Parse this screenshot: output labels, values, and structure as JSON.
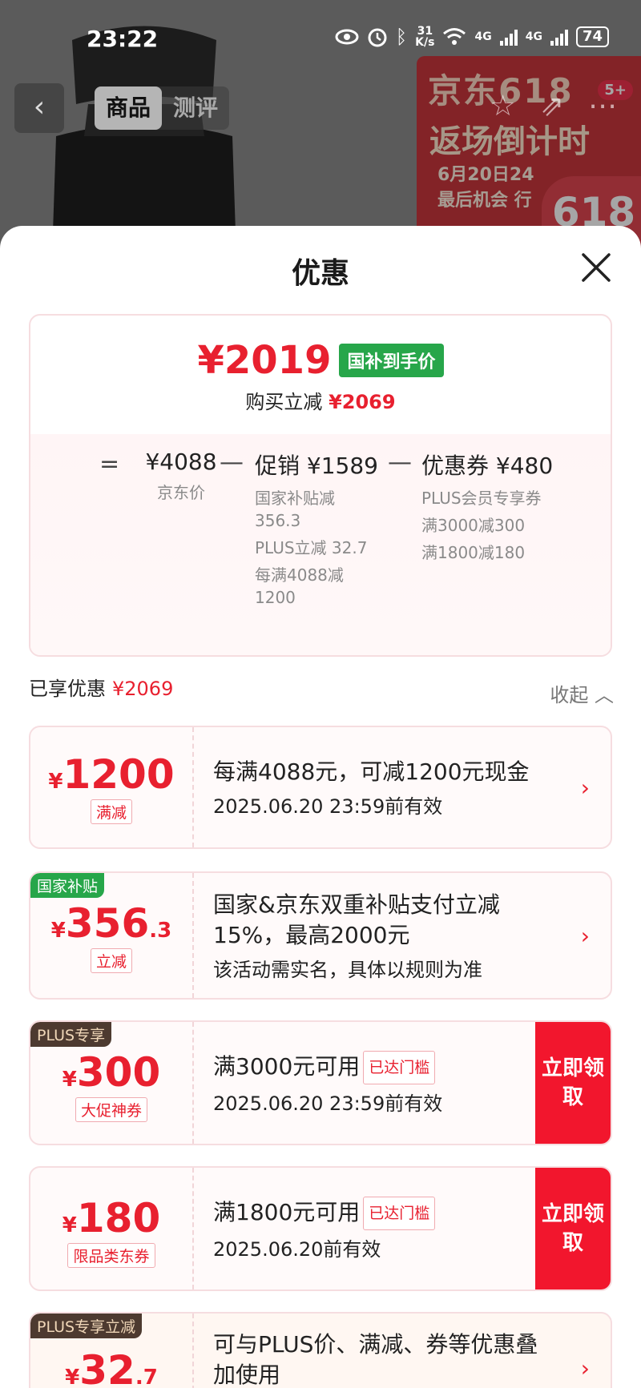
{
  "status_bar": {
    "time": "23:22",
    "net_speed_top": "31",
    "net_speed_bottom": "K/s",
    "net1": "4G",
    "net2": "4G",
    "battery": "74"
  },
  "background": {
    "tabs": [
      "商品",
      "测评"
    ],
    "promo": {
      "line1": "京东618",
      "line2": "返场倒计时",
      "line3": "6月20日24",
      "line4": "最后机会 行",
      "big": "618",
      "badge": "5+"
    }
  },
  "sheet": {
    "title": "优惠"
  },
  "summary": {
    "final_price": "¥2019",
    "final_tag": "国补到手价",
    "save_label": "购买立减",
    "save_value": "¥2069",
    "equals": "=",
    "minus": "—",
    "base": {
      "value": "¥4088",
      "label": "京东价"
    },
    "promo": {
      "head": "促销 ¥1589",
      "items": [
        "国家补贴减 356.3",
        "PLUS立减 32.7",
        "每满4088减 1200"
      ]
    },
    "coupon": {
      "head": "优惠券 ¥480",
      "items": [
        "PLUS会员专享券",
        "满3000减300",
        "满1800减180"
      ]
    }
  },
  "enjoyed": {
    "label": "已享优惠",
    "value": "¥2069",
    "collapse": "收起"
  },
  "coupons": [
    {
      "flag": "",
      "yen": "¥",
      "amount": "1200",
      "decimal": "",
      "label": "满减",
      "title": "每满4088元，可减1200元现金",
      "reached": "",
      "sub": "2025.06.20 23:59前有效",
      "button": ""
    },
    {
      "flag": "国家补贴",
      "yen": "¥",
      "amount": "356",
      "decimal": ".3",
      "label": "立减",
      "title": "国家&京东双重补贴支付立减15%，最高2000元",
      "reached": "",
      "sub": "该活动需实名，具体以规则为准",
      "button": ""
    },
    {
      "flag": "PLUS专享",
      "yen": "¥",
      "amount": "300",
      "decimal": "",
      "label": "大促神券",
      "title": "满3000元可用",
      "reached": "已达门槛",
      "sub": "2025.06.20 23:59前有效",
      "button": "立即领取"
    },
    {
      "flag": "",
      "yen": "¥",
      "amount": "180",
      "decimal": "",
      "label": "限品类东券",
      "title": "满1800元可用",
      "reached": "已达门槛",
      "sub": "2025.06.20前有效",
      "button": "立即领取"
    },
    {
      "flag": "PLUS专享立减",
      "yen": "¥",
      "amount": "32",
      "decimal": ".7",
      "label": "",
      "title": "可与PLUS价、满减、券等优惠叠加使用",
      "reached": "",
      "sub": "",
      "button": ""
    }
  ]
}
